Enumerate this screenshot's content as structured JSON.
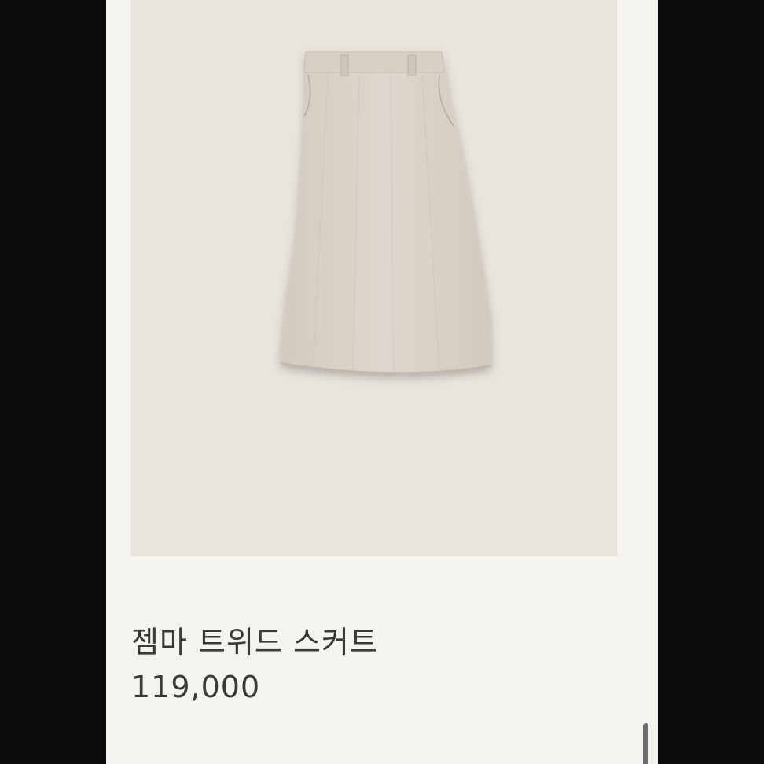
{
  "product": {
    "name": "젬마 트위드 스커트",
    "price": "119,000",
    "image_alt": "skirt-product-photo"
  },
  "colors": {
    "page_background": "#f4f3ee",
    "image_background": "#e9e4dc",
    "skirt_fill": "#d9d2c7",
    "text": "#3a3a3a",
    "side_bars": "#0b0b0b"
  },
  "scroll": {
    "position_fraction": 0.97
  }
}
